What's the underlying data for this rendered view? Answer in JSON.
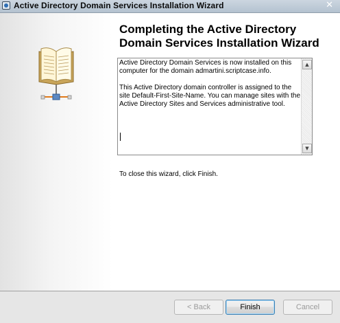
{
  "window": {
    "title": "Active Directory Domain Services Installation Wizard",
    "close_glyph": "✕"
  },
  "banner": {
    "icon": "book-network-icon"
  },
  "main": {
    "heading": "Completing the Active Directory Domain Services Installation Wizard",
    "summary_paragraphs": [
      "Active Directory Domain Services is now installed on this computer for the domain admartini.scriptcase.info.",
      "This Active Directory domain controller is assigned to the site Default-First-Site-Name. You can manage sites with the Active Directory Sites and Services administrative tool."
    ],
    "scroll_up_glyph": "▲",
    "scroll_down_glyph": "▼",
    "close_hint": "To close this wizard, click Finish."
  },
  "buttons": {
    "back": "< Back",
    "finish": "Finish",
    "cancel": "Cancel"
  },
  "colors": {
    "titlebar": "#b4c2d0",
    "bottombar": "#e6e6e6",
    "focus_border": "#3c7fb1"
  }
}
